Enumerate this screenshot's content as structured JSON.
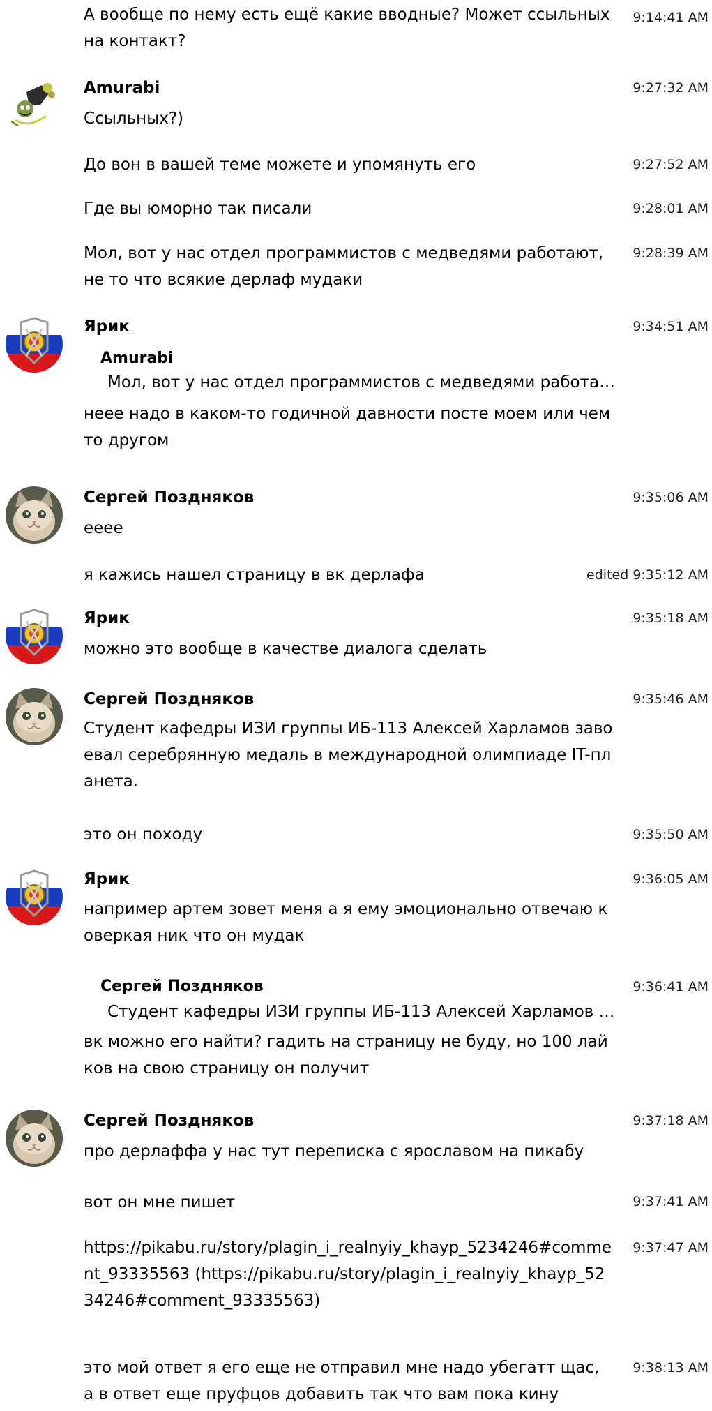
{
  "messages": [
    {
      "text": "А вообще по нему есть ещё какие вводные? Может ссыльных на контакт?",
      "time": "9:14:41 AM"
    },
    {
      "author": "Amurabi",
      "avatar": "amurabi-avatar-icon",
      "text": "Ссыльных?)",
      "time": "9:27:32 AM"
    },
    {
      "text": "До вон в вашей теме можете и упомянуть его",
      "time": "9:27:52 AM"
    },
    {
      "text": "Где вы юморно так писали",
      "time": "9:28:01 AM"
    },
    {
      "text": "Мол, вот у нас отдел программистов с медведями работают, не то что всякие дерлаф мудаки",
      "time": "9:28:39 AM"
    },
    {
      "author": "Ярик",
      "avatar": "flag-emblem-avatar-icon",
      "quote": {
        "author": "Amurabi",
        "text": "Мол, вот у нас отдел программистов с медведями работаю…"
      },
      "text": "неее надо в каком-то годичной давности посте моем или чем то другом",
      "time": "9:34:51 AM"
    },
    {
      "author": "Сергей Поздняков",
      "avatar": "cat-avatar-icon",
      "text": "ееее",
      "time": "9:35:06 AM"
    },
    {
      "text": "я кажись нашел страницу в вк дерлафа",
      "time": "edited 9:35:12 AM"
    },
    {
      "author": "Ярик",
      "avatar": "flag-emblem-avatar-icon",
      "text": "можно это вообще в качестве диалога сделать",
      "time": "9:35:18 AM"
    },
    {
      "author": "Сергей Поздняков",
      "avatar": "cat-avatar-icon",
      "text": "Студент кафедры ИЗИ группы ИБ-113 Алексей Харламов завоевал серебрянную медаль в международной олимпиаде IT-планета.",
      "time": "9:35:46 AM"
    },
    {
      "text": "это он походу",
      "time": "9:35:50 AM"
    },
    {
      "author": "Ярик",
      "avatar": "flag-emblem-avatar-icon",
      "text": "например артем зовет меня а я ему эмоционально отвечаю коверкая ник что он мудак",
      "time": "9:36:05 AM"
    },
    {
      "quote": {
        "author": "Сергей Поздняков",
        "text": "Студент кафедры ИЗИ группы ИБ-113 Алексей Харламов з…"
      },
      "text": "вк можно его найти? гадить на страницу не буду, но 100 лайков на свою страницу он получит",
      "time": "9:36:41 AM"
    },
    {
      "author": "Сергей Поздняков",
      "avatar": "cat-avatar-icon",
      "text": "про дерлаффа у нас тут переписка с ярославом на пикабу",
      "time": "9:37:18 AM"
    },
    {
      "text": "вот он мне пишет",
      "time": "9:37:41 AM"
    },
    {
      "text": "https://pikabu.ru/story/plagin_i_realnyiy_khayp_5234246#comment_93335563 (https://pikabu.ru/story/plagin_i_realnyiy_khayp_5234246#comment_93335563)",
      "time": "9:37:47 AM"
    },
    {
      "text": "это мой ответ я его еще не отправил мне надо убегатт щас, а в ответ еще пруфцов добавить так что вам пока кину",
      "time": "9:38:13 AM"
    }
  ]
}
